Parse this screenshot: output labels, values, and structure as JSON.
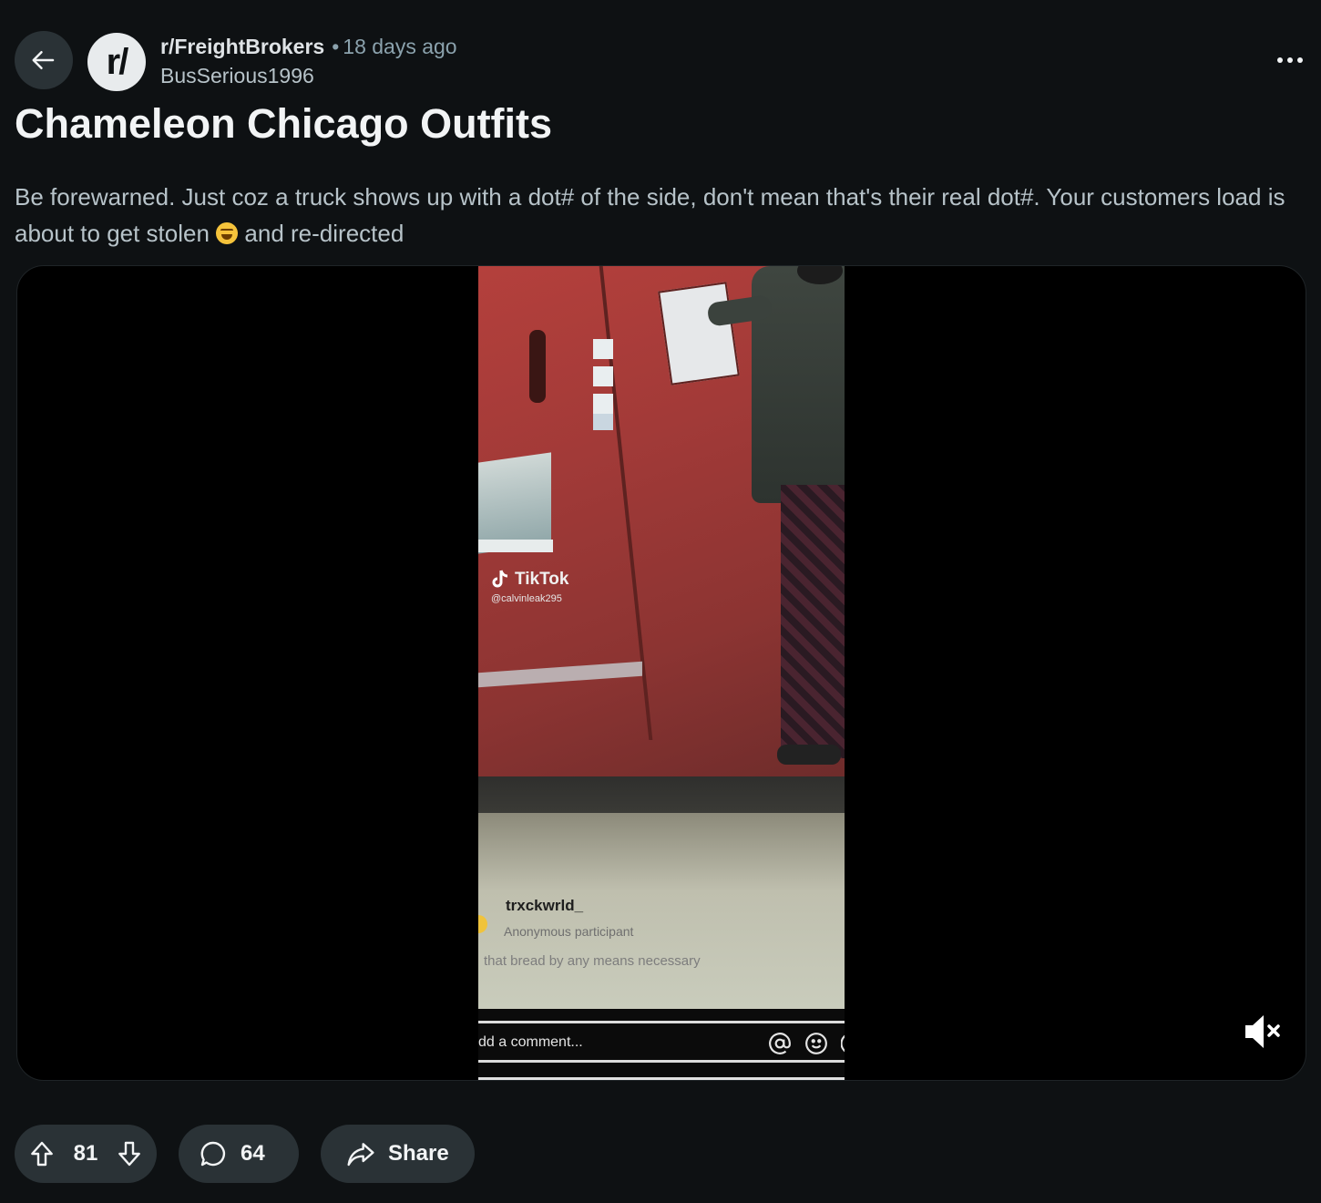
{
  "header": {
    "back_icon": "arrow-left-icon",
    "avatar_text": "r/",
    "subreddit": "r/FreightBrokers",
    "separator": "•",
    "age": "18 days ago",
    "author": "BusSerious1996",
    "more_icon": "more-horizontal-icon"
  },
  "post": {
    "title": "Chameleon Chicago Outfits",
    "body_before_emoji": "Be forewarned. Just coz a truck shows up with a dot# of the side, don't mean that's their real dot#. Your customers load is about to get stolen",
    "emoji_icon": "rolling-on-floor-laughing-emoji-icon",
    "body_after_emoji": "and re-directed"
  },
  "video": {
    "tiktok_brand": "TikTok",
    "tiktok_handle": "@calvinleak295",
    "comment_user": "trxckwrld_",
    "comment_anon": "Anonymous participant",
    "comment_text": "that bread by any means necessary",
    "comment_placeholder": "dd a comment...",
    "mute_icon": "volume-muted-icon",
    "colors": {
      "truck_red": "#a23a38",
      "road": "#c9ccbc"
    }
  },
  "actions": {
    "upvote_icon": "upvote-arrow-icon",
    "score": "81",
    "downvote_icon": "downvote-arrow-icon",
    "comment_icon": "speech-bubble-icon",
    "comments_count": "64",
    "share_icon": "share-arrow-icon",
    "share_label": "Share"
  },
  "colors": {
    "background": "#0e1113",
    "button_bg": "#2a3236",
    "text_primary": "#f2f4f5",
    "text_secondary": "#b7c3c9",
    "text_muted": "#8ba2ad"
  }
}
